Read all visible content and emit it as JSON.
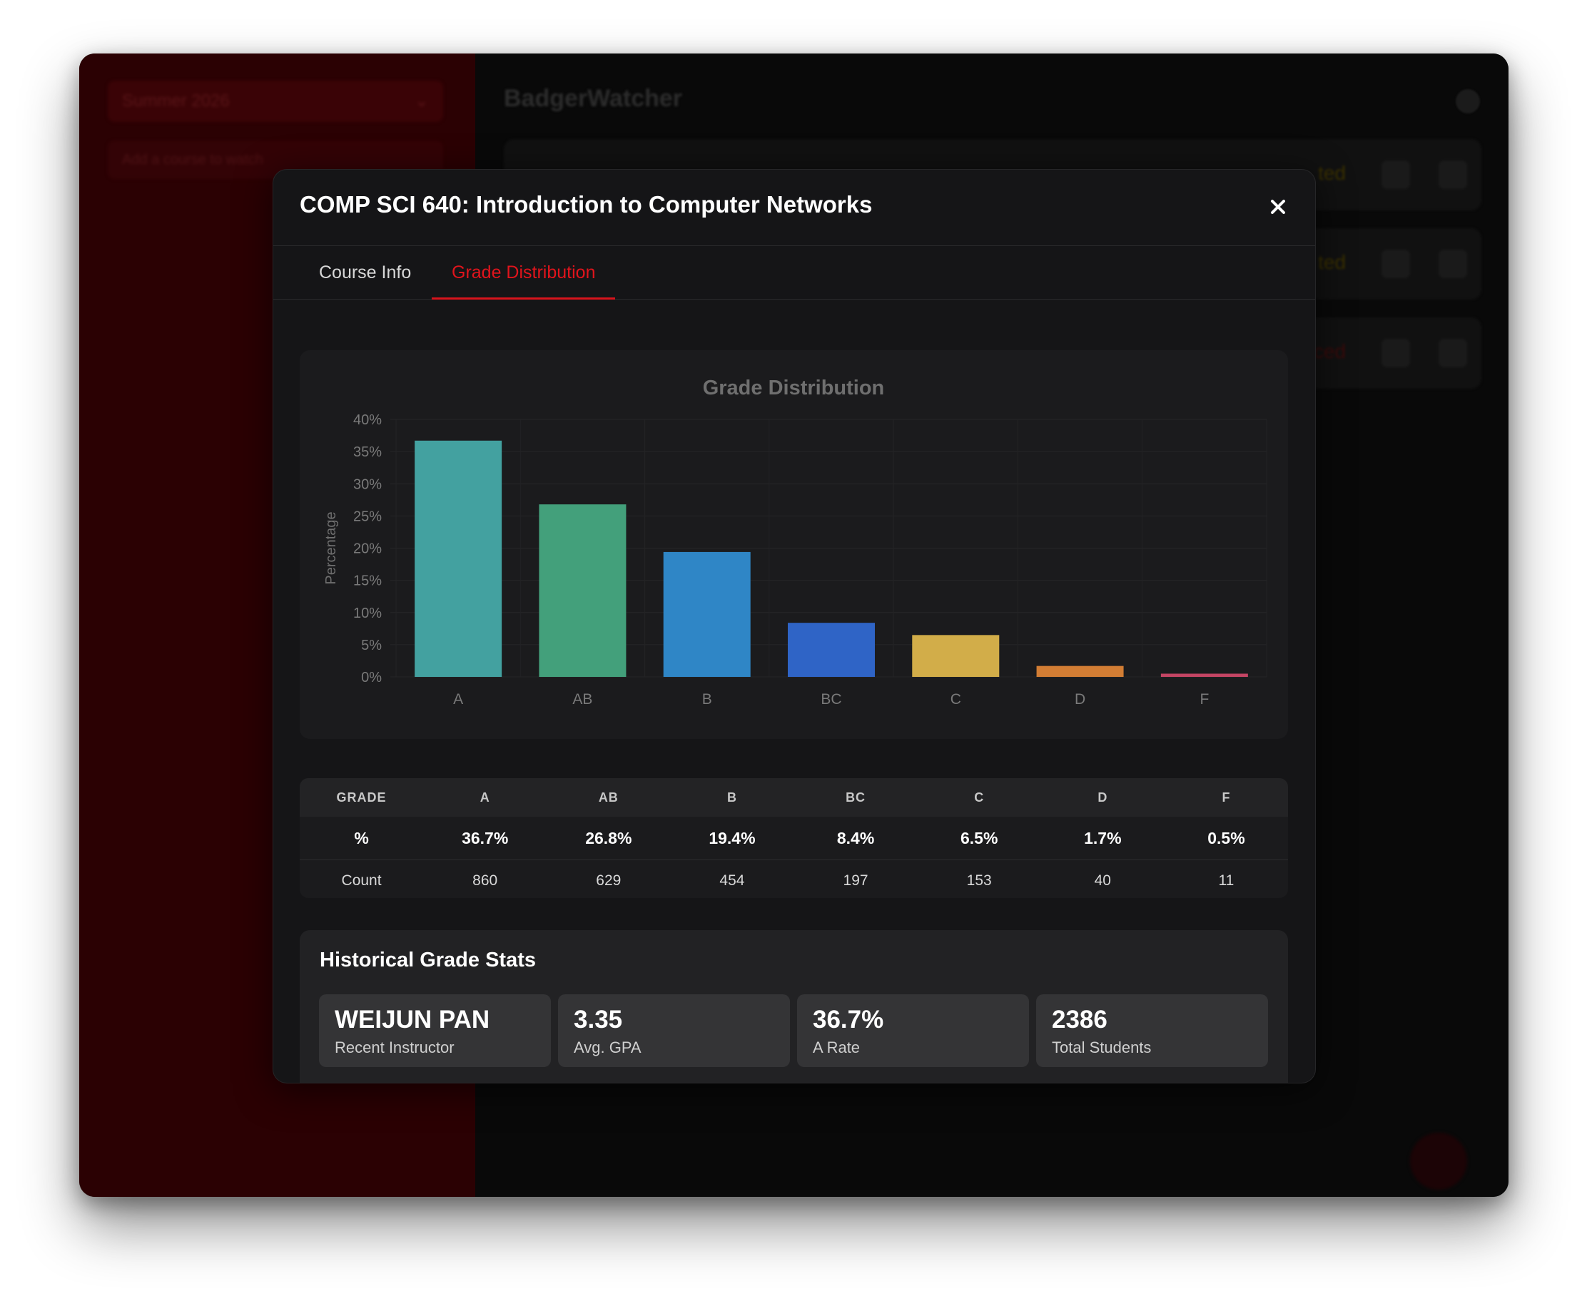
{
  "app": {
    "title": "BadgerWatcher",
    "term_select": "Summer 2026",
    "search_placeholder": "Add a course to watch"
  },
  "background_cards": [
    {
      "status": "ted",
      "status_color": "#f0c000"
    },
    {
      "status": "ted",
      "status_color": "#f0c000"
    },
    {
      "status": "ced",
      "status_color": "#e02020"
    }
  ],
  "modal": {
    "title": "COMP SCI 640: Introduction to Computer Networks",
    "tabs": [
      {
        "label": "Course Info",
        "active": false
      },
      {
        "label": "Grade Distribution",
        "active": true
      }
    ]
  },
  "chart_data": {
    "type": "bar",
    "title": "Grade Distribution",
    "ylabel": "Percentage",
    "xlabel": "",
    "categories": [
      "A",
      "AB",
      "B",
      "BC",
      "C",
      "D",
      "F"
    ],
    "values": [
      36.7,
      26.8,
      19.4,
      8.4,
      6.5,
      1.7,
      0.5
    ],
    "colors": [
      "#43a1a0",
      "#43a07b",
      "#2f86c6",
      "#2f64c6",
      "#d2ad49",
      "#d27d34",
      "#c44564"
    ],
    "ylim": [
      0,
      40
    ],
    "yticks": [
      "0%",
      "5%",
      "10%",
      "15%",
      "20%",
      "25%",
      "30%",
      "35%",
      "40%"
    ],
    "grid": true
  },
  "grade_table": {
    "header_label": "GRADE",
    "grades": [
      "A",
      "AB",
      "B",
      "BC",
      "C",
      "D",
      "F"
    ],
    "pct_label": "%",
    "percents": [
      "36.7%",
      "26.8%",
      "19.4%",
      "8.4%",
      "6.5%",
      "1.7%",
      "0.5%"
    ],
    "count_label": "Count",
    "counts": [
      "860",
      "629",
      "454",
      "197",
      "153",
      "40",
      "11"
    ]
  },
  "stats": {
    "title": "Historical Grade Stats",
    "items": [
      {
        "value": "WEIJUN PAN",
        "label": "Recent Instructor"
      },
      {
        "value": "3.35",
        "label": "Avg. GPA"
      },
      {
        "value": "36.7%",
        "label": "A Rate"
      },
      {
        "value": "2386",
        "label": "Total Students"
      }
    ]
  }
}
